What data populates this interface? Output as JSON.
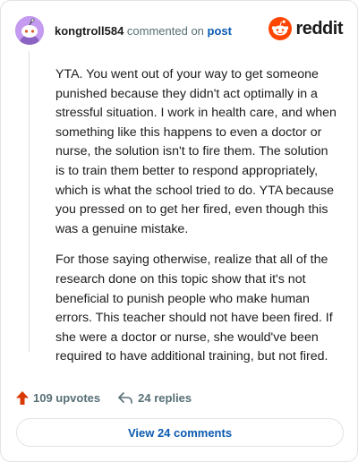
{
  "header": {
    "username": "kongtroll584",
    "action": "commented on",
    "post_link": "post",
    "brand": "reddit"
  },
  "comment": {
    "paragraphs": [
      "YTA. You went out of your way to get someone punished because they didn't act optimally in a stressful situation. I work in health care, and when something like this happens to even a doctor or nurse, the solution isn't to fire them. The solution is to train them better to respond appropriately, which is what the school tried to do. YTA because you pressed on to get her fired, even though this was a genuine mistake.",
      "For those saying otherwise, realize that all of the research done on this topic show that it's not beneficial to punish people who make human errors. This teacher should not have been fired. If she were a doctor or nurse, she would've been required to have additional training, but not fired."
    ]
  },
  "footer": {
    "upvotes": "109 upvotes",
    "replies": "24 replies",
    "view_comments": "View 24 comments"
  },
  "colors": {
    "upvote": "#d93900",
    "link": "#0a5ab0",
    "brand": "#ff4500",
    "avatar": "#c59bf2"
  },
  "icons": {
    "avatar": "snoo-avatar-icon",
    "logo": "reddit-snoo-icon",
    "upvote": "upvote-arrow-icon",
    "reply": "reply-arrow-icon"
  }
}
